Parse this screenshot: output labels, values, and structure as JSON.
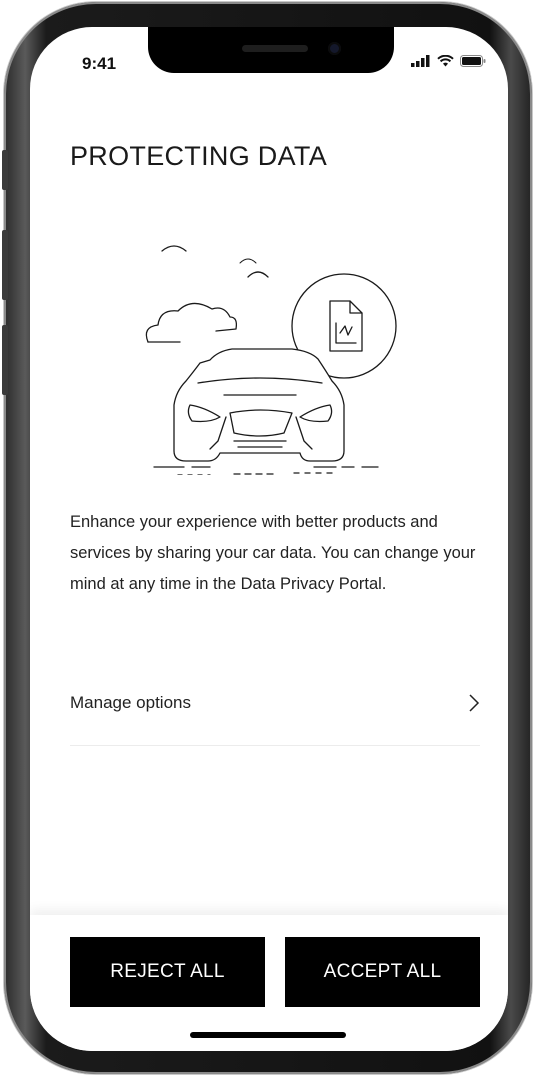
{
  "status_bar": {
    "time": "9:41"
  },
  "page": {
    "title": "PROTECTING DATA",
    "description": "Enhance your experience with better products and services by sharing your car data. You can change your mind at any time in the Data Privacy Portal.",
    "illustration_icon": "car-data-document-illustration"
  },
  "manage": {
    "label": "Manage options",
    "icon": "chevron-right-icon"
  },
  "actions": {
    "reject_label": "REJECT ALL",
    "accept_label": "ACCEPT ALL"
  },
  "colors": {
    "button_bg": "#000000",
    "button_text": "#ffffff",
    "text": "#222222"
  }
}
